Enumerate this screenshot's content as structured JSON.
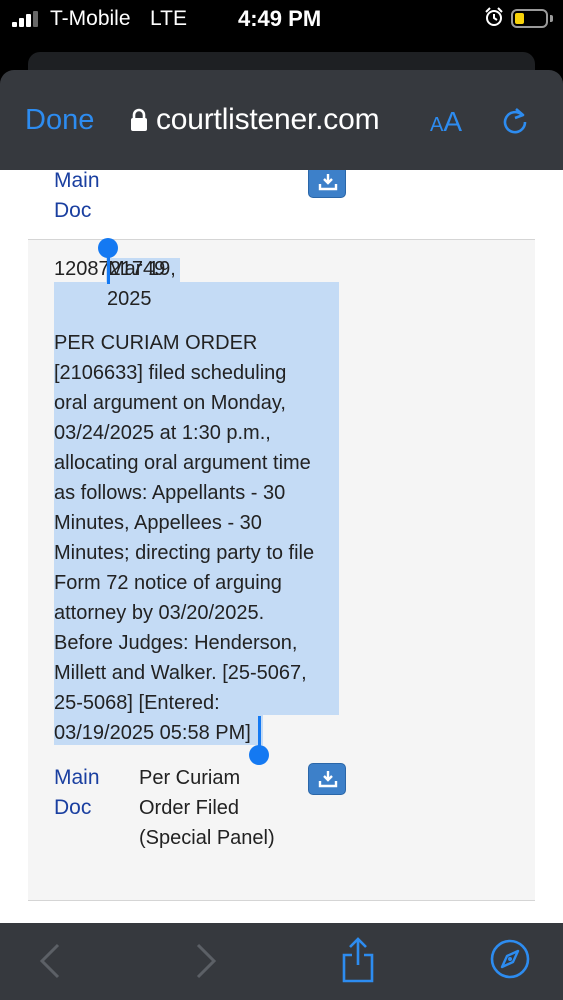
{
  "status_bar": {
    "carrier": "T-Mobile",
    "network": "LTE",
    "time": "4:49 PM",
    "battery_color": "#f7d20a"
  },
  "browser": {
    "done_label": "Done",
    "url": "courtlistener.com",
    "text_size_label_small": "A",
    "text_size_label_big": "A",
    "accent_color": "#2d8cf0",
    "icons": [
      "lock-icon",
      "reload-icon"
    ]
  },
  "docket": {
    "previous_entry": {
      "main_doc_label": "Main Doc",
      "download_icon": "download-icon"
    },
    "entry": {
      "number": "1208721749",
      "date_line1": "Mar 19,",
      "date_line2": "2025",
      "description_lines": [
        "PER CURIAM ORDER",
        "[2106633] filed scheduling",
        "oral argument on Monday,",
        "03/24/2025 at 1:30 p.m.,",
        "allocating oral argument time",
        "as follows: Appellants - 30",
        "Minutes, Appellees - 30",
        "Minutes; directing party to file",
        "Form 72 notice of arguing",
        "attorney by 03/20/2025.",
        "Before Judges: Henderson,",
        "Millett and Walker. [25-5067,",
        "25-5068] [Entered:",
        "03/19/2025 05:58 PM]"
      ],
      "selection_color": "#c4dbf5",
      "document": {
        "main_doc_label": "Main Doc",
        "description": "Per Curiam Order Filed (Special Panel)",
        "download_icon": "download-icon"
      }
    }
  },
  "toolbar": {
    "icons": [
      "back-icon",
      "forward-icon",
      "share-icon",
      "compass-icon"
    ]
  }
}
